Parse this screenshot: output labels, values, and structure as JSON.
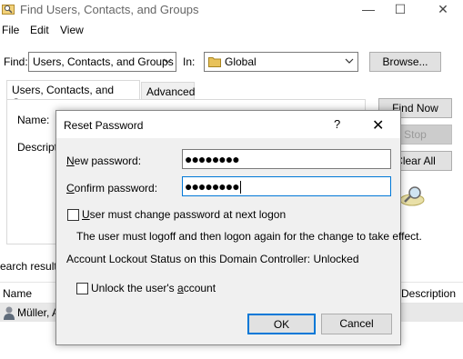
{
  "window": {
    "title": "Find Users, Contacts, and Groups",
    "controls": {
      "minimize": "—",
      "maximize": "☐",
      "close": "✕"
    }
  },
  "menu": {
    "file": "File",
    "edit": "Edit",
    "view": "View"
  },
  "search": {
    "find_label": "Find:",
    "find_value": "Users, Contacts, and Groups",
    "in_label": "In:",
    "in_value": "Global",
    "browse_label": "Browse..."
  },
  "tabs": [
    {
      "label": "Users, Contacts, and Groups",
      "active": true
    },
    {
      "label": "Advanced",
      "active": false
    }
  ],
  "form": {
    "name_label": "Name:",
    "description_label": "Descripti"
  },
  "actions": {
    "find_now": "Find Now",
    "stop": "Stop",
    "clear_all": "Clear All"
  },
  "results": {
    "label": "earch results",
    "columns": [
      "Name",
      "Description"
    ],
    "rows": [
      {
        "name": "Müller, A"
      }
    ]
  },
  "dialog": {
    "title": "Reset Password",
    "help": "?",
    "close": "✕",
    "new_password_label": "New password:",
    "new_password_value": "●●●●●●●●",
    "confirm_password_label": "Confirm password:",
    "confirm_password_value": "●●●●●●●●",
    "must_change_label": "User must change password at next logon",
    "must_change_checked": false,
    "logoff_note": "The user must logoff and then logon again for the change to take effect.",
    "lockout_status": "Account Lockout Status on this Domain Controller: Unlocked",
    "unlock_label": "Unlock the user's account",
    "unlock_checked": false,
    "ok_label": "OK",
    "cancel_label": "Cancel"
  },
  "colors": {
    "focus_border": "#0078d7",
    "button_face": "#e1e1e1",
    "dialog_bg": "#f0f0f0"
  }
}
